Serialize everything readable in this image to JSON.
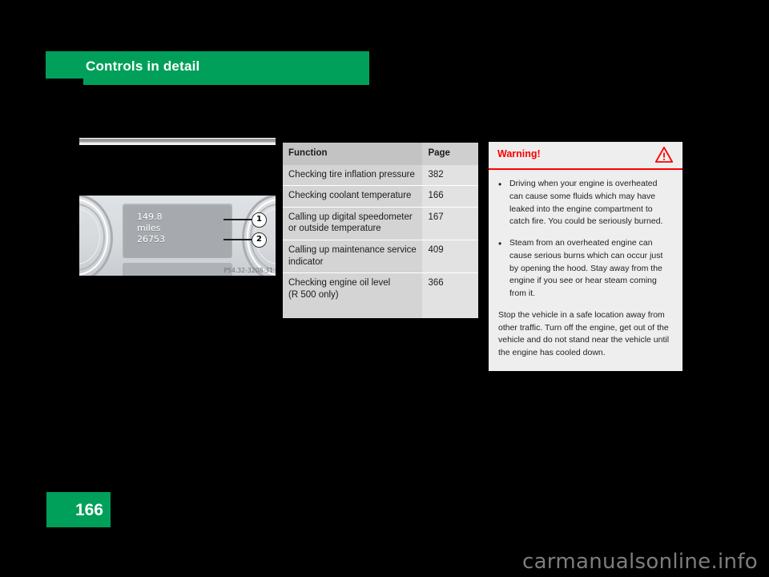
{
  "header": {
    "chapter_title": "Controls in detail",
    "accent_color": "#00a05a"
  },
  "illustration": {
    "figure_code": "P54.32-3208-31",
    "lcd": {
      "trip_distance": "149.8",
      "units": "miles",
      "odometer": "26753"
    },
    "callouts": [
      {
        "number": "1"
      },
      {
        "number": "2"
      }
    ]
  },
  "table": {
    "columns": [
      "Function",
      "Page"
    ],
    "rows": [
      {
        "function": "Checking tire inflation pressure",
        "page": "382"
      },
      {
        "function": "Checking coolant temperature",
        "page": "166"
      },
      {
        "function": "Calling up digital speedometer or outside temperature",
        "page": "167"
      },
      {
        "function": "Calling up maintenance service indicator",
        "page": "409"
      },
      {
        "function": "Checking engine oil level\n(R 500 only)",
        "page": "366"
      }
    ]
  },
  "warning": {
    "title": "Warning!",
    "icon": "warning-triangle-icon",
    "accent_color": "#ff0000",
    "bullets": [
      "Driving when your engine is overheated can cause some fluids which may have leaked into the engine compartment to catch fire. You could be seriously burned.",
      "Steam from an overheated engine can cause serious burns which can occur just by opening the hood. Stay away from the engine if you see or hear steam coming from it."
    ],
    "bullet_marker": "•",
    "closing": "Stop the vehicle in a safe location away from other traffic. Turn off the engine, get out of the vehicle and do not stand near the vehicle until the engine has cooled down."
  },
  "footer": {
    "page_number": "166",
    "watermark": "carmanualsonline.info"
  }
}
